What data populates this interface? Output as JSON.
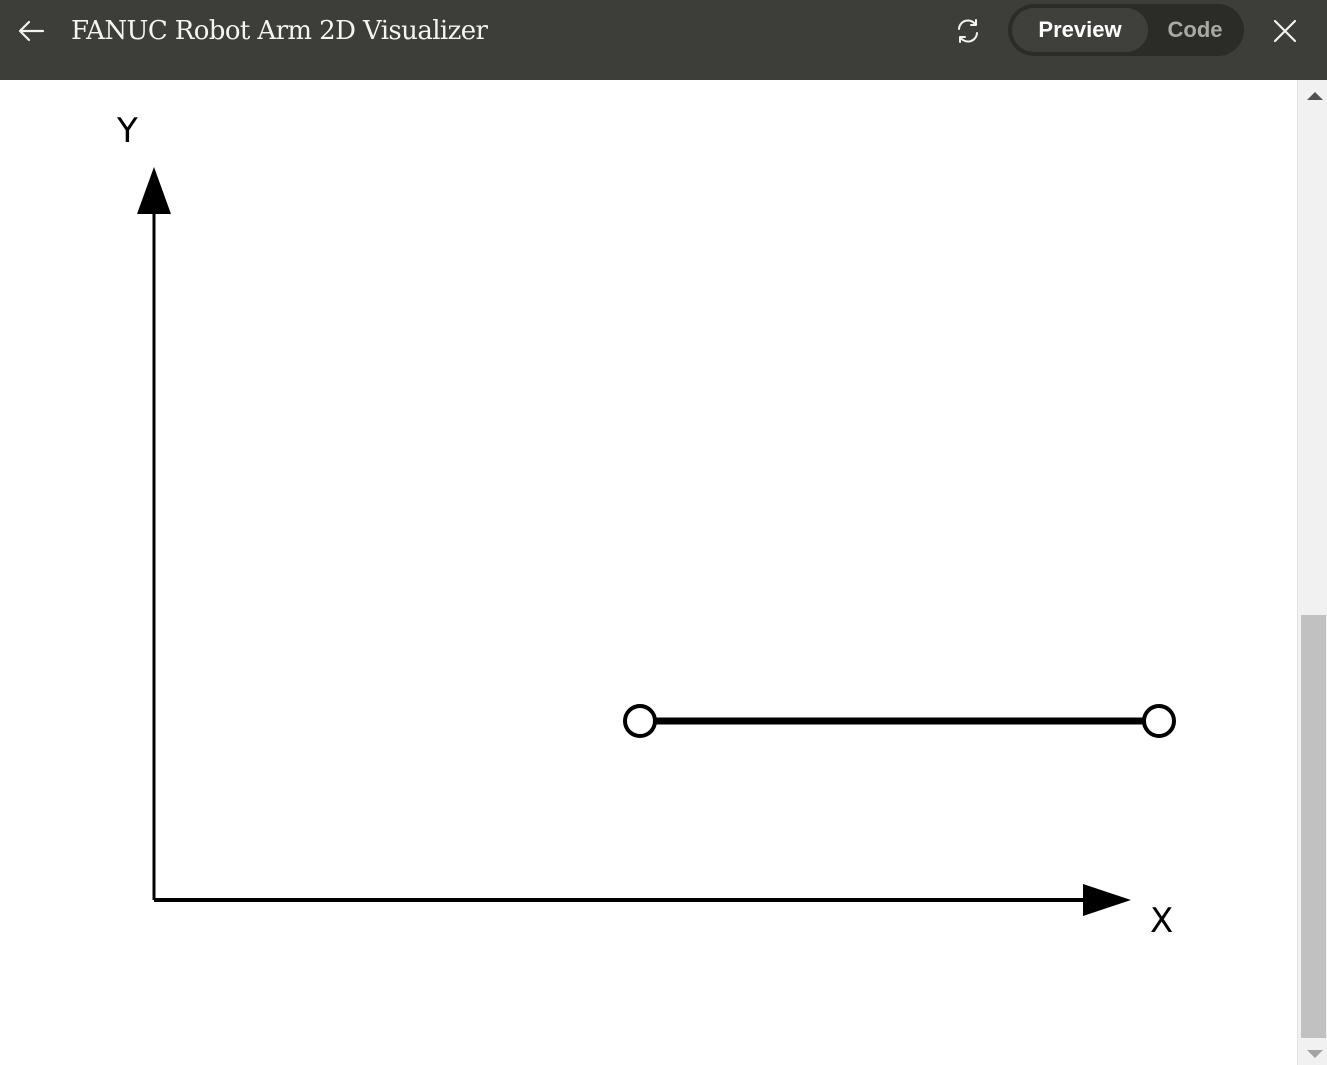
{
  "header": {
    "title": "FANUC Robot Arm 2D Visualizer",
    "back_icon": "arrow-left-icon",
    "refresh_icon": "refresh-icon",
    "close_icon": "close-icon",
    "tabs": [
      {
        "label": "Preview",
        "active": true
      },
      {
        "label": "Code",
        "active": false
      }
    ]
  },
  "visualizer": {
    "x_axis_label": "X",
    "y_axis_label": "Y",
    "arm_segments": 1,
    "joints": 2
  },
  "colors": {
    "header_bg": "#3d3e39",
    "toggle_bg": "#2b2c28",
    "active_tab_bg": "#3f403b",
    "drawing": "#000000",
    "canvas_bg": "#ffffff"
  }
}
